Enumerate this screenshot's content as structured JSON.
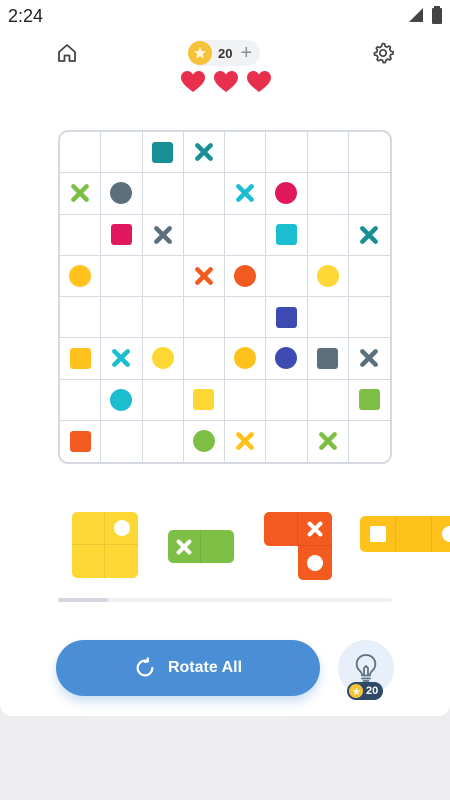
{
  "status_bar": {
    "time": "2:24"
  },
  "header": {
    "coins": "20",
    "add_coins": "+",
    "lives": 3
  },
  "colors": {
    "teal": "#178f94",
    "cyan": "#1bbdd0",
    "green": "#7dbf44",
    "grey": "#5c6f7c",
    "magenta": "#e2185f",
    "orange": "#f35a1f",
    "yellow": "#fdd835",
    "amber": "#ffc21c",
    "navy": "#3c4ab1",
    "heart": "#e82f4d",
    "coin": "#f5c23a",
    "rotate_button": "#4a8fd6"
  },
  "board": {
    "rows": 8,
    "cols": 8,
    "markers": [
      {
        "row": 0,
        "col": 2,
        "shape": "square",
        "color": "teal"
      },
      {
        "row": 0,
        "col": 3,
        "shape": "x",
        "color": "teal"
      },
      {
        "row": 1,
        "col": 0,
        "shape": "x",
        "color": "green"
      },
      {
        "row": 1,
        "col": 1,
        "shape": "circle",
        "color": "grey"
      },
      {
        "row": 1,
        "col": 4,
        "shape": "x",
        "color": "cyan"
      },
      {
        "row": 1,
        "col": 5,
        "shape": "circle",
        "color": "magenta"
      },
      {
        "row": 2,
        "col": 1,
        "shape": "square",
        "color": "magenta"
      },
      {
        "row": 2,
        "col": 2,
        "shape": "x",
        "color": "grey"
      },
      {
        "row": 2,
        "col": 5,
        "shape": "square",
        "color": "cyan"
      },
      {
        "row": 2,
        "col": 7,
        "shape": "x",
        "color": "teal"
      },
      {
        "row": 3,
        "col": 0,
        "shape": "circle",
        "color": "amber"
      },
      {
        "row": 3,
        "col": 3,
        "shape": "x",
        "color": "orange"
      },
      {
        "row": 3,
        "col": 4,
        "shape": "circle",
        "color": "orange"
      },
      {
        "row": 3,
        "col": 6,
        "shape": "circle",
        "color": "yellow"
      },
      {
        "row": 4,
        "col": 5,
        "shape": "square",
        "color": "navy"
      },
      {
        "row": 5,
        "col": 0,
        "shape": "square",
        "color": "amber"
      },
      {
        "row": 5,
        "col": 1,
        "shape": "x",
        "color": "cyan"
      },
      {
        "row": 5,
        "col": 2,
        "shape": "circle",
        "color": "yellow"
      },
      {
        "row": 5,
        "col": 4,
        "shape": "circle",
        "color": "amber"
      },
      {
        "row": 5,
        "col": 5,
        "shape": "circle",
        "color": "navy"
      },
      {
        "row": 5,
        "col": 6,
        "shape": "square",
        "color": "grey"
      },
      {
        "row": 5,
        "col": 7,
        "shape": "x",
        "color": "grey"
      },
      {
        "row": 6,
        "col": 1,
        "shape": "circle",
        "color": "cyan"
      },
      {
        "row": 6,
        "col": 3,
        "shape": "square",
        "color": "yellow"
      },
      {
        "row": 6,
        "col": 7,
        "shape": "square",
        "color": "green"
      },
      {
        "row": 7,
        "col": 0,
        "shape": "square",
        "color": "orange"
      },
      {
        "row": 7,
        "col": 3,
        "shape": "circle",
        "color": "green"
      },
      {
        "row": 7,
        "col": 4,
        "shape": "x",
        "color": "amber"
      },
      {
        "row": 7,
        "col": 6,
        "shape": "x",
        "color": "green"
      }
    ]
  },
  "pieces": [
    {
      "name": "yellow-square-piece",
      "color": "yellow",
      "cells": [
        {
          "r": 0,
          "c": 0
        },
        {
          "r": 0,
          "c": 1,
          "mark": "circle"
        },
        {
          "r": 1,
          "c": 0
        },
        {
          "r": 1,
          "c": 1
        }
      ]
    },
    {
      "name": "green-domino-piece",
      "color": "green",
      "cells": [
        {
          "r": 0,
          "c": 0,
          "mark": "x"
        },
        {
          "r": 0,
          "c": 1
        }
      ]
    },
    {
      "name": "orange-corner-piece",
      "color": "orange",
      "cells": [
        {
          "r": 0,
          "c": 0
        },
        {
          "r": 0,
          "c": 1,
          "mark": "x"
        },
        {
          "r": 1,
          "c": 1,
          "mark": "circle"
        }
      ]
    },
    {
      "name": "amber-bar-piece",
      "color": "amber",
      "cells": [
        {
          "r": 0,
          "c": 0,
          "mark": "square"
        },
        {
          "r": 0,
          "c": 1
        },
        {
          "r": 0,
          "c": 2,
          "mark": "circle"
        }
      ]
    }
  ],
  "tray": {
    "scroll_progress": 0.15
  },
  "actions": {
    "rotate_all": "Rotate All",
    "hint_cost": "20"
  }
}
